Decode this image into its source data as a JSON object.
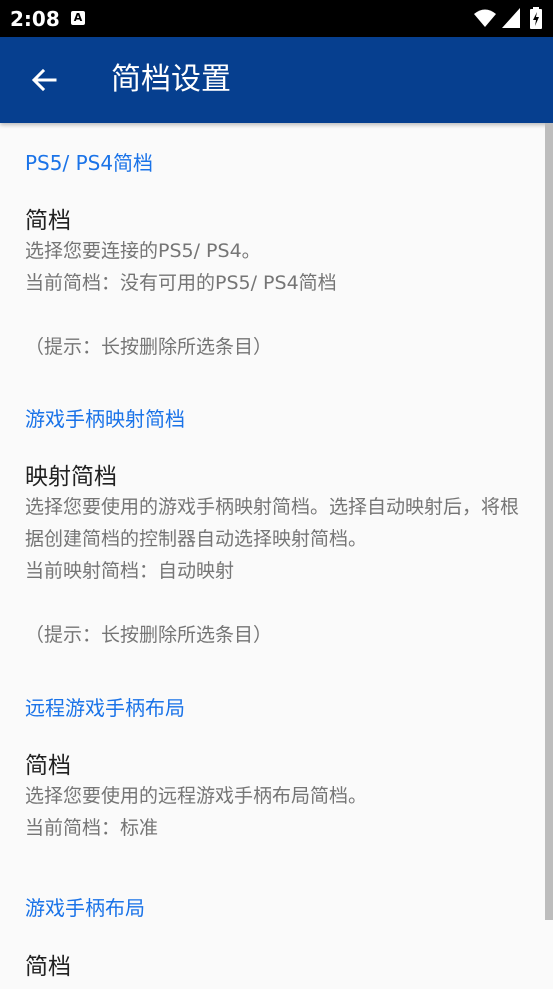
{
  "status_bar": {
    "time": "2:08",
    "notification_icon": "A"
  },
  "app_bar": {
    "title": "简档设置"
  },
  "sections": [
    {
      "header": "PS5/ PS4简档",
      "items": [
        {
          "title": "简档",
          "summary": "选择您要连接的PS5/ PS4。\n当前简档：没有可用的PS5/ PS4简档\n\n（提示：长按删除所选条目）"
        }
      ]
    },
    {
      "header": "游戏手柄映射简档",
      "items": [
        {
          "title": "映射简档",
          "summary": "选择您要使用的游戏手柄映射简档。选择自动映射后，将根据创建简档的控制器自动选择映射简档。\n当前映射简档：自动映射\n\n（提示：长按删除所选条目）"
        }
      ]
    },
    {
      "header": "远程游戏手柄布局",
      "items": [
        {
          "title": "简档",
          "summary": "选择您要使用的远程游戏手柄布局简档。\n当前简档：标准"
        }
      ]
    },
    {
      "header": "游戏手柄布局",
      "items": [
        {
          "title": "简档",
          "summary": ""
        }
      ]
    }
  ],
  "colors": {
    "app_bar": "#063f8f",
    "accent": "#1a73e8",
    "background": "#fafafa"
  }
}
